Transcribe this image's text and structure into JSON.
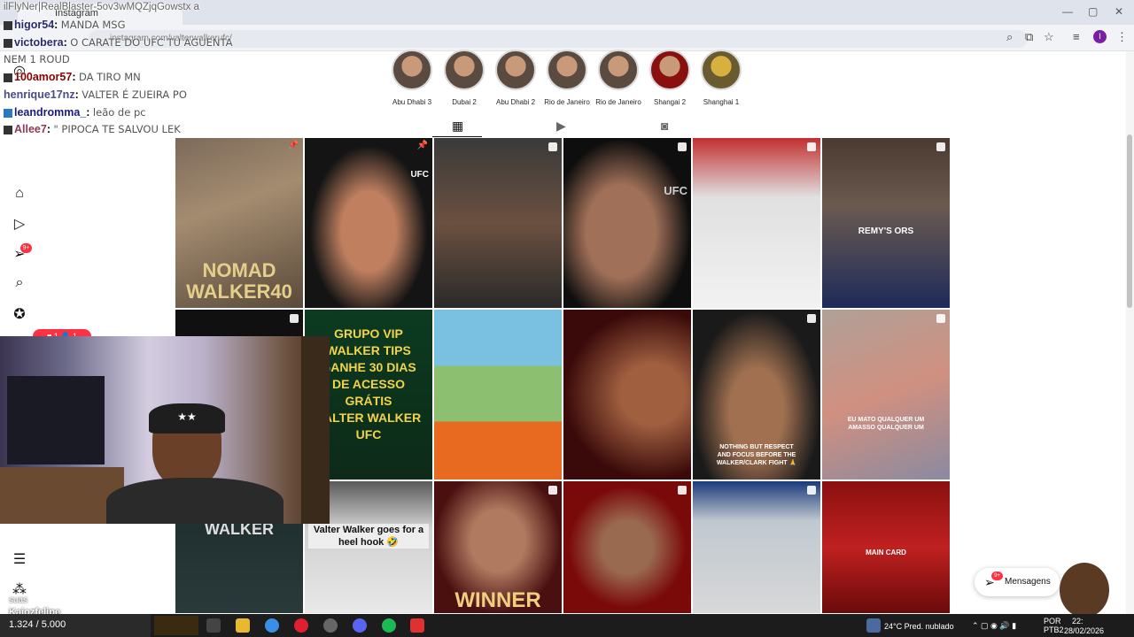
{
  "browser": {
    "tab_title": "Instagram",
    "window_controls": [
      "—",
      "▢",
      "✕"
    ],
    "url": "instagram.com/valterwalkerufc/"
  },
  "chat": {
    "header": "ilFlyNer|RealBlaster-5ov3wMQZjqGowstx a",
    "messages": [
      {
        "user": "higor54",
        "text": "MANDA MSG"
      },
      {
        "user": "victobera",
        "text": "O CARATE DO UFC TU AGUENTA"
      },
      {
        "user": "",
        "text": "NEM 1 ROUD"
      },
      {
        "user": "100amor57",
        "text": "DA TIRO MN"
      },
      {
        "user": "henrique17nz",
        "text": "VALTER É ZUEIRA PO"
      },
      {
        "user": "leandromma_",
        "text": "leão de pc"
      },
      {
        "user": "Allee7",
        "text": "\" PIPOCA TE SALVOU LEK"
      }
    ]
  },
  "stories": [
    {
      "label": "Abu Dhabi 3"
    },
    {
      "label": "Dubai 2"
    },
    {
      "label": "Abu Dhabi 2"
    },
    {
      "label": "Rio de Janeiro"
    },
    {
      "label": "Rio de Janeiro"
    },
    {
      "label": "Shangai 2"
    },
    {
      "label": "Shanghai 1"
    }
  ],
  "profile_tabs": [
    "grid-icon",
    "reels-icon",
    "tagged-icon"
  ],
  "sidebar": {
    "icons": [
      "instagram-icon",
      "home-icon",
      "reels-icon",
      "messages-icon",
      "search-icon",
      "explore-icon",
      "menu-icon",
      "more-icon"
    ],
    "notif_badge": "9+",
    "notif_pill": "♥ 1  👤 1"
  },
  "grid_tiles": [
    {
      "caption": "NOMAD\nWALKER40",
      "pinned": true
    },
    {
      "caption": "UFC",
      "pinned": true
    },
    {
      "caption": ""
    },
    {
      "caption": "UFC"
    },
    {
      "caption": ""
    },
    {
      "caption": "REMY'S    ORS"
    },
    {
      "caption": ""
    },
    {
      "caption": "GRUPO VIP\nWALKER TIPS\nGANHE 30 DIAS\nDE ACESSO GRÁTIS\nVALTER WALKER UFC"
    },
    {
      "caption": ""
    },
    {
      "caption": ""
    },
    {
      "caption": "NOTHING BUT RESPECT\nAND FOCUS BEFORE THE\nWALKER/CLARK FIGHT 🙏"
    },
    {
      "caption": "EU MATO QUALQUER UM\nAMASSO QUALQUER UM"
    },
    {
      "caption": "WALKER"
    },
    {
      "caption": "Valter Walker goes for a\nheel hook 🤣"
    },
    {
      "caption": "WINNER"
    },
    {
      "caption": ""
    },
    {
      "caption": ""
    },
    {
      "caption": "MAIN CARD"
    }
  ],
  "messages_pill": {
    "label": "Mensagens",
    "badge": "9+"
  },
  "stream_overlay": {
    "name": "Kaiozfelipe",
    "count": "1.324 / 5.000",
    "text": "suas"
  },
  "taskbar": {
    "weather": "24°C  Pred. nublado",
    "lang": "POR\nPTB2",
    "time": "22:",
    "date": "28/02/2026"
  },
  "colors": {
    "accent": "#0095f6",
    "notif": "#ff3040",
    "taskbar": "#1c1c1c"
  }
}
